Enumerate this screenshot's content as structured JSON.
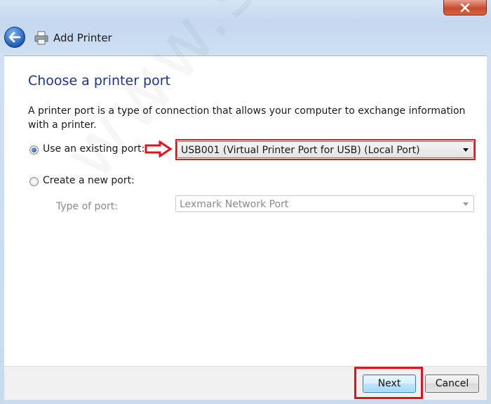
{
  "window": {
    "title": "Add Printer",
    "close_symbol": "✕"
  },
  "page": {
    "title": "Choose a printer port",
    "description": "A printer port is a type of connection that allows your computer to exchange information with a printer."
  },
  "options": {
    "existing": {
      "label": "Use an existing port:",
      "selected": true,
      "value": "USB001 (Virtual Printer Port for USB) (Local Port)"
    },
    "create": {
      "label": "Create a new port:",
      "selected": false,
      "type_label": "Type of port:",
      "type_value": "Lexmark Network Port"
    }
  },
  "buttons": {
    "next": "Next",
    "cancel": "Cancel"
  },
  "watermark": "www.setprinter.co",
  "icons": {
    "back": "back-arrow-icon",
    "printer": "printer-icon",
    "annotation": "red-arrow-icon",
    "close": "close-icon"
  },
  "colors": {
    "title": "#1e3287",
    "annotation": "#e0141c",
    "close_button": "#c84b2e"
  }
}
